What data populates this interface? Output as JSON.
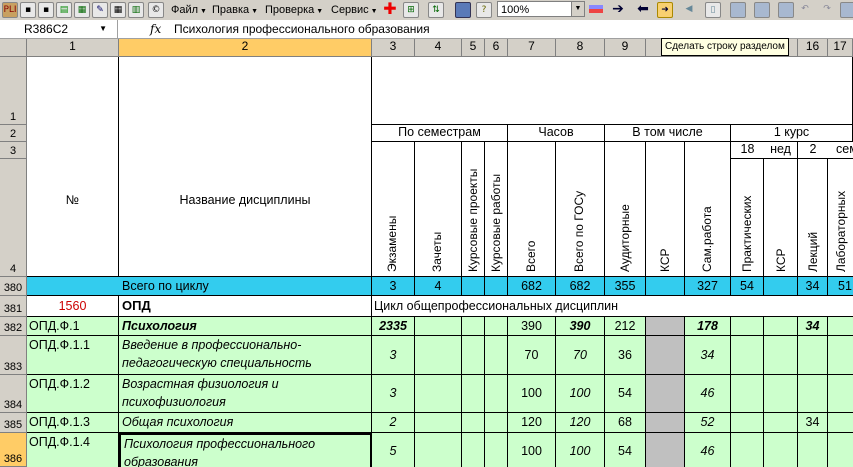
{
  "toolbar": {
    "menus": [
      "Файл",
      "Правка",
      "Проверка",
      "Сервис"
    ],
    "zoom": "100%"
  },
  "formula_bar": {
    "cell_ref": "R386C2",
    "fx": "fx",
    "content": "Психология профессионального образования"
  },
  "tooltip": "Сделать строку разделом",
  "columns": [
    "1",
    "2",
    "3",
    "4",
    "5",
    "6",
    "7",
    "8",
    "9",
    "",
    "",
    "",
    "",
    "",
    "16",
    "17"
  ],
  "rows": [
    "1",
    "2",
    "3",
    "4",
    "380",
    "381",
    "382",
    "383",
    "384",
    "385",
    "386"
  ],
  "header": {
    "no": "№",
    "discipline": "Название дисциплины",
    "by_semester": "По семестрам",
    "hours": "Часов",
    "including": "В том числе",
    "course1": "1 курс",
    "weeks_count": "18",
    "weeks_label": "нед",
    "sem2": "2",
    "sem_label": "сем",
    "exams": "Экзамены",
    "credits": "Зачеты",
    "course_projects": "Курсовые проекты",
    "course_works": "Курсовые работы",
    "total": "Всего",
    "total_gos": "Всего по ГОСу",
    "classroom": "Аудиторные",
    "ksr": "КСР",
    "self_work": "Сам.работа",
    "practical": "Практических",
    "ksr2": "КСР",
    "lectures": "Лекций",
    "labs": "Лабораторных"
  },
  "table_rows": [
    {
      "row": "380",
      "code": "",
      "name": "Всего по циклу",
      "exams": "3",
      "credits": "4",
      "total": "682",
      "total_gos": "682",
      "classroom": "355",
      "ksr": "",
      "self": "327",
      "practical": "54",
      "ksr2": "",
      "lectures": "34",
      "labs": "51"
    },
    {
      "row": "381",
      "code": "1560",
      "name": "ОПД",
      "desc": "Цикл общепрофессиональных дисциплин"
    },
    {
      "row": "382",
      "code": "ОПД.Ф.1",
      "name": "Психология",
      "exams": "2335",
      "credits": "",
      "total": "390",
      "total_gos": "390",
      "classroom": "212",
      "ksr": "",
      "self": "178",
      "practical": "",
      "ksr2": "",
      "lectures": "34",
      "labs": ""
    },
    {
      "row": "383",
      "code": "ОПД.Ф.1.1",
      "name": "Введение в профессионально-",
      "name2": "педагогическую специальность",
      "exams": "3",
      "total": "70",
      "total_gos": "70",
      "classroom": "36",
      "self": "34"
    },
    {
      "row": "384",
      "code": "ОПД.Ф.1.2",
      "name": "Возрастная физиология и",
      "name2": "психофизиология",
      "exams": "3",
      "total": "100",
      "total_gos": "100",
      "classroom": "54",
      "self": "46"
    },
    {
      "row": "385",
      "code": "ОПД.Ф.1.3",
      "name": "Общая психология",
      "exams": "2",
      "total": "120",
      "total_gos": "120",
      "classroom": "68",
      "self": "52",
      "lectures": "34"
    },
    {
      "row": "386",
      "code": "ОПД.Ф.1.4",
      "name": "Психология профессионального",
      "name2": "образования",
      "exams": "5",
      "total": "100",
      "total_gos": "100",
      "classroom": "54",
      "self": "46"
    }
  ],
  "colors": {
    "cyan": "#33ccee",
    "green": "#ccffcc",
    "gray": "#c0c0c0",
    "selected_header": "#ffcc66",
    "red": "#cc0000"
  }
}
